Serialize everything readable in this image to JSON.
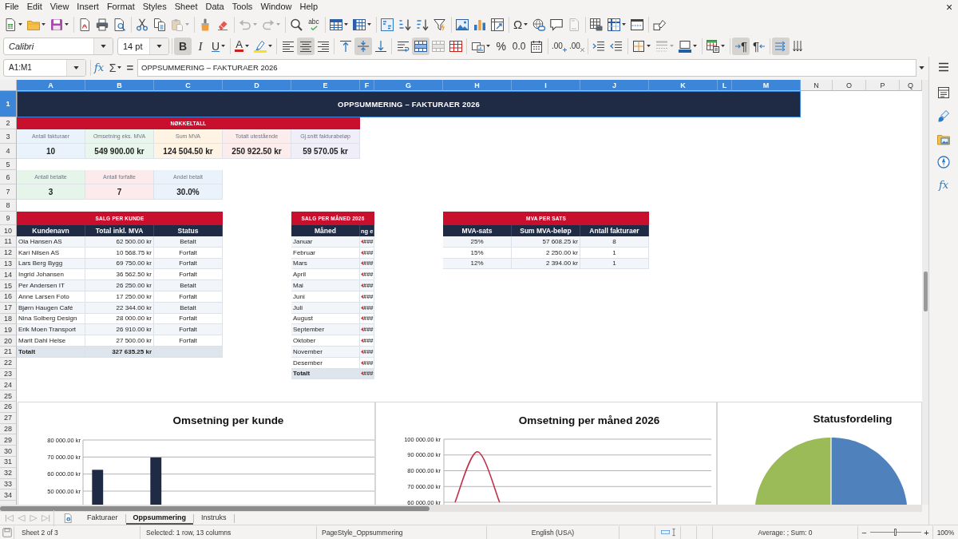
{
  "menu_bar": {
    "items": [
      "File",
      "Edit",
      "View",
      "Insert",
      "Format",
      "Styles",
      "Sheet",
      "Data",
      "Tools",
      "Window",
      "Help"
    ],
    "close_glyph": "×"
  },
  "standard_toolbar": {
    "groups": [
      [
        {
          "kind": "new",
          "disabled": false
        },
        {
          "kind": "open",
          "disabled": false
        },
        {
          "kind": "save",
          "disabled": false
        }
      ],
      [
        {
          "kind": "export-pdf",
          "disabled": false
        },
        {
          "kind": "print",
          "disabled": false
        },
        {
          "kind": "print-preview",
          "disabled": false
        }
      ],
      [
        {
          "kind": "cut",
          "disabled": false
        },
        {
          "kind": "copy",
          "disabled": false
        },
        {
          "kind": "paste",
          "disabled": true
        }
      ],
      [
        {
          "kind": "clone-formatting",
          "disabled": false
        },
        {
          "kind": "clear-formatting",
          "disabled": false
        }
      ],
      [
        {
          "kind": "undo",
          "disabled": true
        },
        {
          "kind": "redo",
          "disabled": true
        }
      ],
      [
        {
          "kind": "find-replace",
          "disabled": false
        },
        {
          "kind": "spelling",
          "glyph": "abc",
          "disabled": false
        }
      ],
      [
        {
          "kind": "rows",
          "disabled": false
        },
        {
          "kind": "columns",
          "disabled": false
        }
      ],
      [
        {
          "kind": "sort",
          "disabled": false
        },
        {
          "kind": "sort-ascending",
          "disabled": false
        },
        {
          "kind": "sort-descending",
          "disabled": false
        },
        {
          "kind": "autofilter",
          "disabled": false
        }
      ],
      [
        {
          "kind": "image",
          "disabled": false
        },
        {
          "kind": "chart",
          "disabled": false
        },
        {
          "kind": "pivot-table",
          "disabled": false
        }
      ],
      [
        {
          "kind": "special-character",
          "glyph": "Ω",
          "disabled": false
        },
        {
          "kind": "hyperlink",
          "disabled": false
        },
        {
          "kind": "comment",
          "disabled": false
        },
        {
          "kind": "header-footer",
          "disabled": true
        }
      ],
      [
        {
          "kind": "print-area",
          "disabled": false
        },
        {
          "kind": "freeze",
          "disabled": false
        },
        {
          "kind": "split-window",
          "disabled": false
        }
      ],
      [
        {
          "kind": "draw-functions",
          "disabled": false
        }
      ]
    ]
  },
  "formatting_toolbar": {
    "font_name": "Calibri",
    "font_size": "14 pt",
    "groups": [
      [
        {
          "kind": "bold",
          "glyph": "B",
          "on": true,
          "disabled": false
        },
        {
          "kind": "italic",
          "glyph": "I",
          "on": false,
          "disabled": false
        },
        {
          "kind": "underline",
          "glyph": "U",
          "on": false,
          "disabled": false
        }
      ],
      [
        {
          "kind": "font-color",
          "glyph": "A",
          "on": false,
          "disabled": false
        },
        {
          "kind": "highlight",
          "on": false,
          "disabled": false
        }
      ],
      [
        {
          "kind": "align-left",
          "on": false,
          "disabled": false
        },
        {
          "kind": "align-center",
          "on": true,
          "disabled": false
        },
        {
          "kind": "align-right",
          "on": false,
          "disabled": false
        }
      ],
      [
        {
          "kind": "align-top",
          "on": false,
          "disabled": false
        },
        {
          "kind": "align-middle",
          "on": true,
          "disabled": false
        },
        {
          "kind": "align-bottom",
          "on": false,
          "disabled": false
        }
      ],
      [
        {
          "kind": "wrap-text",
          "on": false,
          "disabled": false
        },
        {
          "kind": "merge-center",
          "on": true,
          "disabled": false
        },
        {
          "kind": "merge",
          "on": false,
          "disabled": true
        },
        {
          "kind": "unmerge",
          "on": false,
          "disabled": false
        }
      ],
      [
        {
          "kind": "number-format",
          "on": false,
          "disabled": false
        },
        {
          "kind": "percent",
          "glyph": "%",
          "on": false,
          "disabled": false
        },
        {
          "kind": "decimal",
          "glyph": "0.0",
          "on": false,
          "disabled": false
        },
        {
          "kind": "date",
          "on": false,
          "disabled": false
        }
      ],
      [
        {
          "kind": "add-decimal",
          "glyph": ".00",
          "on": false,
          "disabled": false
        },
        {
          "kind": "delete-decimal",
          "glyph": ".00",
          "on": false,
          "disabled": false
        }
      ],
      [
        {
          "kind": "indent",
          "on": false,
          "disabled": false
        },
        {
          "kind": "outdent",
          "on": false,
          "disabled": false
        }
      ],
      [
        {
          "kind": "borders",
          "on": false,
          "disabled": false
        },
        {
          "kind": "border-style",
          "on": false,
          "disabled": true
        },
        {
          "kind": "border-color",
          "on": false,
          "disabled": false
        }
      ],
      [
        {
          "kind": "conditional",
          "on": false,
          "disabled": false
        }
      ],
      [
        {
          "kind": "left-to-right",
          "glyph": "¶",
          "on": true,
          "disabled": false
        },
        {
          "kind": "right-to-left",
          "glyph": "¶",
          "on": false,
          "disabled": false
        }
      ],
      [
        {
          "kind": "text-horizontal",
          "on": true,
          "disabled": false
        },
        {
          "kind": "text-vertical",
          "on": false,
          "disabled": false
        }
      ]
    ]
  },
  "formula_bar": {
    "name_box": "A1:M1",
    "function_glyph": "fx",
    "sum_glyph": "Σ",
    "equals_glyph": "=",
    "content": "OPPSUMMERING – FAKTURAER 2026"
  },
  "sidebar": {
    "tabs": [
      {
        "kind": "properties",
        "selected": false
      },
      {
        "kind": "styles",
        "selected": false
      },
      {
        "kind": "gallery",
        "selected": false
      },
      {
        "kind": "navigator",
        "selected": false
      },
      {
        "kind": "functions",
        "glyph": "fx",
        "selected": false
      }
    ]
  },
  "sheet": {
    "column_headers": [
      {
        "label": "A",
        "selected": true
      },
      {
        "label": "B",
        "selected": true
      },
      {
        "label": "C",
        "selected": true
      },
      {
        "label": "D",
        "selected": true
      },
      {
        "label": "E",
        "selected": true
      },
      {
        "label": "F",
        "selected": true
      },
      {
        "label": "G",
        "selected": true
      },
      {
        "label": "H",
        "selected": true
      },
      {
        "label": "I",
        "selected": true
      },
      {
        "label": "J",
        "selected": true
      },
      {
        "label": "K",
        "selected": true
      },
      {
        "label": "L",
        "selected": true
      },
      {
        "label": "M",
        "selected": true
      },
      {
        "label": "N",
        "selected": false
      },
      {
        "label": "O",
        "selected": false
      },
      {
        "label": "P",
        "selected": false
      },
      {
        "label": "Q",
        "selected": false
      }
    ],
    "row_headers": [
      {
        "label": "1",
        "selected": true
      },
      {
        "label": "2",
        "selected": false
      },
      {
        "label": "3",
        "selected": false
      },
      {
        "label": "4",
        "selected": false
      },
      {
        "label": "5",
        "selected": false
      },
      {
        "label": "6",
        "selected": false
      },
      {
        "label": "7",
        "selected": false
      },
      {
        "label": "8",
        "selected": false
      },
      {
        "label": "9",
        "selected": false
      },
      {
        "label": "10",
        "selected": false
      },
      {
        "label": "11",
        "selected": false
      },
      {
        "label": "12",
        "selected": false
      },
      {
        "label": "13",
        "selected": false
      },
      {
        "label": "14",
        "selected": false
      },
      {
        "label": "15",
        "selected": false
      },
      {
        "label": "16",
        "selected": false
      },
      {
        "label": "17",
        "selected": false
      },
      {
        "label": "18",
        "selected": false
      },
      {
        "label": "19",
        "selected": false
      },
      {
        "label": "20",
        "selected": false
      },
      {
        "label": "21",
        "selected": false
      },
      {
        "label": "22",
        "selected": false
      },
      {
        "label": "23",
        "selected": false
      },
      {
        "label": "24",
        "selected": false
      },
      {
        "label": "25",
        "selected": false
      },
      {
        "label": "26",
        "selected": false
      },
      {
        "label": "27",
        "selected": false
      },
      {
        "label": "28",
        "selected": false
      },
      {
        "label": "29",
        "selected": false
      },
      {
        "label": "30",
        "selected": false
      },
      {
        "label": "31",
        "selected": false
      },
      {
        "label": "32",
        "selected": false
      },
      {
        "label": "33",
        "selected": false
      },
      {
        "label": "34",
        "selected": false
      }
    ],
    "title_banner": {
      "text": "OPPSUMMERING – FAKTURAER 2026",
      "selected": true
    },
    "key_figures": {
      "heading": "NØKKELTALL",
      "items": [
        {
          "label": "Antall fakturaer",
          "value": "10",
          "color": "#eaf2fb"
        },
        {
          "label": "Omsetning eks. MVA",
          "value": "549 900.00 kr",
          "color": "#e9f6ee"
        },
        {
          "label": "Sum MVA",
          "value": "124 504.50 kr",
          "color": "#fff3e3"
        },
        {
          "label": "Totalt utestående",
          "value": "250 922.50 kr",
          "color": "#fdecec"
        },
        {
          "label": "Gj.snitt fakturabeløp",
          "value": "59 570.05 kr",
          "color": "#f0eef9"
        }
      ]
    },
    "payment_status": {
      "items": [
        {
          "label": "Antall betalte",
          "value": "3",
          "color": "#e6f5ea"
        },
        {
          "label": "Antall forfalte",
          "value": "7",
          "color": "#fdeaea"
        },
        {
          "label": "Andel betalt",
          "value": "30.0%",
          "color": "#eaf2fb"
        }
      ]
    },
    "customer_sales": {
      "heading": "SALG PER KUNDE",
      "columns": [
        "Kundenavn",
        "Total inkl. MVA",
        "Status"
      ],
      "rows": [
        [
          "Ola Hansen AS",
          "62 500.00 kr",
          "Betalt"
        ],
        [
          "Kari Nilsen AS",
          "10 568.75 kr",
          "Forfalt"
        ],
        [
          "Lars Berg Bygg",
          "69 750.00 kr",
          "Forfalt"
        ],
        [
          "Ingrid Johansen",
          "36 562.50 kr",
          "Forfalt"
        ],
        [
          "Per Andersen IT",
          "26 250.00 kr",
          "Betalt"
        ],
        [
          "Anne Larsen Foto",
          "17 250.00 kr",
          "Forfalt"
        ],
        [
          "Bjørn Haugen Café",
          "22 344.00 kr",
          "Betalt"
        ],
        [
          "Nina Solberg Design",
          "28 000.00 kr",
          "Forfalt"
        ],
        [
          "Erik Moen Transport",
          "26 910.00 kr",
          "Forfalt"
        ],
        [
          "Marit Dahl Helse",
          "27 500.00 kr",
          "Forfalt"
        ]
      ],
      "total": {
        "label": "Totalt",
        "amount": "327 635.25 kr"
      }
    },
    "monthly_sales": {
      "heading": "SALG PER MÅNED 2026",
      "columns": [
        "Måned",
        "ng e"
      ],
      "rows": [
        {
          "month": "Januar",
          "value": "###"
        },
        {
          "month": "Februar",
          "value": "###"
        },
        {
          "month": "Mars",
          "value": "###"
        },
        {
          "month": "April",
          "value": "###"
        },
        {
          "month": "Mai",
          "value": "###"
        },
        {
          "month": "Juni",
          "value": "###"
        },
        {
          "month": "Juli",
          "value": "###"
        },
        {
          "month": "August",
          "value": "###"
        },
        {
          "month": "September",
          "value": "###"
        },
        {
          "month": "Oktober",
          "value": "###"
        },
        {
          "month": "November",
          "value": "###"
        },
        {
          "month": "Desember",
          "value": "###"
        }
      ],
      "total": {
        "label": "Totalt",
        "value": "###"
      }
    },
    "vat_summary": {
      "heading": "MVA PER SATS",
      "columns": [
        "MVA-sats",
        "Sum MVA-beløp",
        "Antall fakturaer"
      ],
      "rows": [
        [
          "25%",
          "57 608.25 kr",
          "8"
        ],
        [
          "15%",
          "2 250.00 kr",
          "1"
        ],
        [
          "12%",
          "2 394.00 kr",
          "1"
        ]
      ]
    },
    "charts": [
      {
        "kind": "plot",
        "chart_data": {
          "type": "bar",
          "title": "Omsetning per kunde",
          "categories": [
            null,
            null,
            null,
            null,
            null,
            null,
            null,
            null,
            null,
            null
          ],
          "ylim": [
            42000,
            80000
          ],
          "yticks": [
            {
              "value": 80000,
              "label": "80 000.00 kr"
            },
            {
              "value": 70000,
              "label": "70 000.00 kr"
            },
            {
              "value": 60000,
              "label": "60 000.00 kr"
            },
            {
              "value": 50000,
              "label": "50 000.00 kr"
            }
          ],
          "grid": true,
          "series": [
            {
              "color": "#1f2a44",
              "values": [
                62500,
                null,
                69750,
                null,
                null,
                null,
                null,
                null,
                null,
                null
              ]
            }
          ]
        }
      },
      {
        "kind": "plot",
        "chart_data": {
          "type": "line",
          "title": "Omsetning per måned 2026",
          "categories": [
            null,
            null,
            null,
            null,
            null,
            null,
            null,
            null,
            null,
            null,
            null,
            null
          ],
          "ylim": [
            58500,
            100000
          ],
          "yticks": [
            {
              "value": 100000,
              "label": "100 000.00 kr"
            },
            {
              "value": 90000,
              "label": "90 000.00 kr"
            },
            {
              "value": 80000,
              "label": "80 000.00 kr"
            },
            {
              "value": 70000,
              "label": "70 000.00 kr"
            },
            {
              "value": 60000,
              "label": "60 000.00 kr"
            }
          ],
          "grid": true,
          "series": [
            {
              "color": "#c0304a",
              "values": [
                60000,
                92000,
                60000,
                null,
                null,
                null,
                null,
                null,
                null,
                null,
                null,
                null
              ]
            }
          ]
        }
      },
      {
        "kind": "pie",
        "title": "Statusfordeling"
      }
    ]
  },
  "sheet_tabs": {
    "navigation": [
      {
        "kind": "first",
        "disabled": true
      },
      {
        "kind": "previous",
        "disabled": true
      },
      {
        "kind": "next",
        "disabled": true
      },
      {
        "kind": "last",
        "disabled": true
      }
    ],
    "tabs": [
      {
        "label": "Fakturaer",
        "selected": false
      },
      {
        "label": "Oppsummering",
        "selected": true
      },
      {
        "label": "Instruks",
        "selected": false
      }
    ]
  },
  "status_bar": {
    "sheet": "Sheet 2 of 3",
    "selection": "Selected: 1 row, 13 columns",
    "page_style": "PageStyle_Oppsummering",
    "language": "English (USA)",
    "summary": "Average: ; Sum: 0",
    "zoom_out_glyph": "−",
    "zoom_in_glyph": "+",
    "zoom_slider": {
      "level": 0.5
    },
    "zoom": "100%"
  }
}
